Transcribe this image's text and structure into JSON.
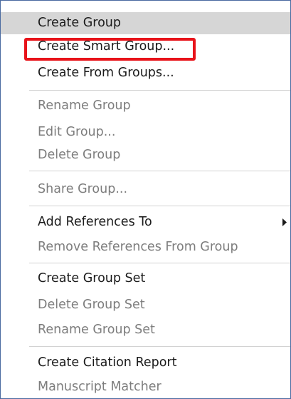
{
  "context_menu": {
    "items": [
      {
        "label": "Create Group",
        "enabled": true,
        "hovered": true
      },
      {
        "label": "Create Smart Group...",
        "enabled": true,
        "highlighted": true
      },
      {
        "label": "Create From Groups...",
        "enabled": true
      },
      {
        "label": "Rename Group",
        "enabled": false
      },
      {
        "label": "Edit Group...",
        "enabled": false
      },
      {
        "label": "Delete Group",
        "enabled": false
      },
      {
        "label": "Share Group...",
        "enabled": false
      },
      {
        "label": "Add References To",
        "enabled": true,
        "has_submenu": true
      },
      {
        "label": "Remove References From Group",
        "enabled": false
      },
      {
        "label": "Create Group Set",
        "enabled": true
      },
      {
        "label": "Delete Group Set",
        "enabled": false
      },
      {
        "label": "Rename Group Set",
        "enabled": false
      },
      {
        "label": "Create Citation Report",
        "enabled": true
      },
      {
        "label": "Manuscript Matcher",
        "enabled": false
      }
    ],
    "highlight_color": "#e8131a",
    "hover_color": "#d6d6d6",
    "border_color": "#4a6aa0",
    "submenu_icon": "submenu-arrow-icon"
  }
}
